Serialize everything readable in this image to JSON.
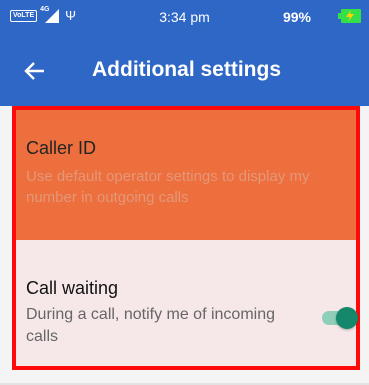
{
  "status_bar": {
    "volte": "VoLTE",
    "network": "4G",
    "time": "3:34 pm",
    "battery": "99%",
    "icons": [
      "signal-icon",
      "usb-icon",
      "battery-charging-icon"
    ]
  },
  "app_bar": {
    "title": "Additional settings",
    "back_icon": "arrow-left-icon",
    "color": "#2f67c6"
  },
  "settings": [
    {
      "title": "Caller ID",
      "summary": "Use default operator settings to display my number in outgoing calls",
      "highlight_color": "#ec6f3d"
    },
    {
      "title": "Call waiting",
      "summary": "During a call, notify me of incoming calls",
      "toggle_on": true,
      "accent": "#15876b"
    }
  ],
  "frame_color": "#ff0a0a"
}
